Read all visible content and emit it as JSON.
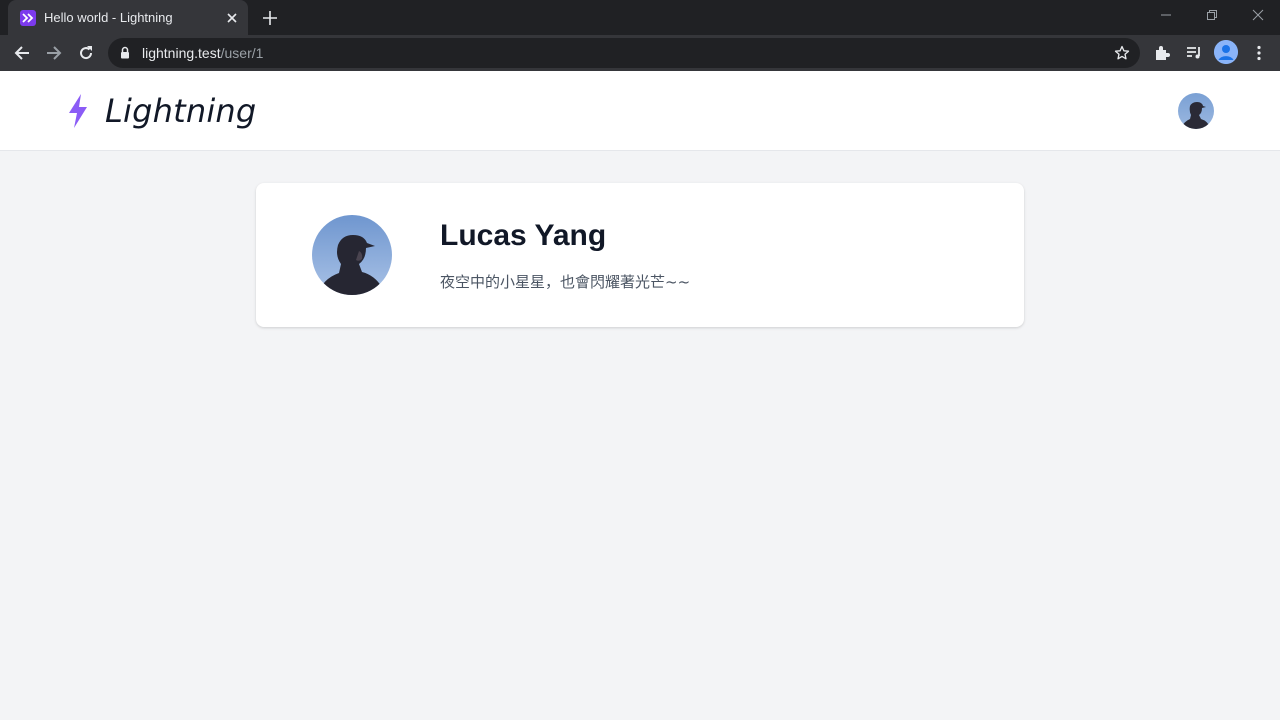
{
  "browser": {
    "tab_title": "Hello world - Lightning",
    "url_host": "lightning.test",
    "url_path": "/user/1",
    "icons": [
      "tab-favicon",
      "close-icon",
      "plus-icon",
      "minimize-icon",
      "restore-icon",
      "close-window-icon",
      "back-icon",
      "forward-icon",
      "reload-icon",
      "lock-icon",
      "star-icon",
      "extensions-icon",
      "media-icon",
      "profile-icon",
      "more-icon"
    ]
  },
  "site": {
    "brand_name": "Lightning",
    "brand_color": "#8b5cf6"
  },
  "profile": {
    "name": "Lucas Yang",
    "bio": "夜空中的小星星，也會閃耀著光芒~~"
  },
  "colors": {
    "page_bg": "#f3f4f6",
    "chrome_dark": "#202124",
    "chrome_toolbar": "#35363a",
    "accent": "#7c3aed"
  }
}
